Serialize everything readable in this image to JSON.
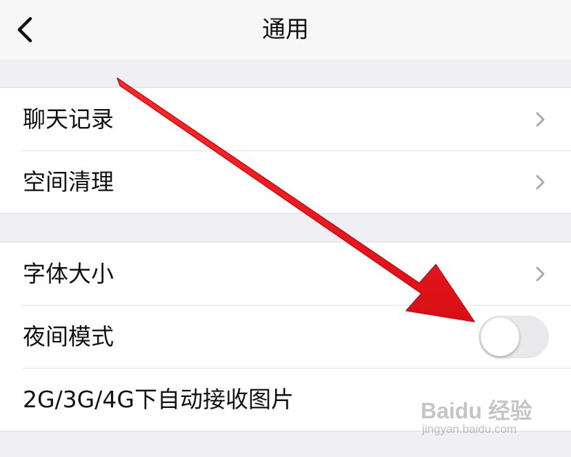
{
  "header": {
    "title": "通用",
    "back_icon": "chevron-left-icon"
  },
  "groups": [
    {
      "items": [
        {
          "label": "聊天记录",
          "accessory": "chevron-right-icon"
        },
        {
          "label": "空间清理",
          "accessory": "chevron-right-icon"
        }
      ]
    },
    {
      "items": [
        {
          "label": "字体大小",
          "accessory": "chevron-right-icon"
        },
        {
          "label": "夜间模式",
          "accessory": "toggle",
          "toggle_on": false
        },
        {
          "label": "2G/3G/4G下自动接收图片",
          "accessory": "none"
        }
      ]
    }
  ],
  "annotation": {
    "arrow_color": "#e8141c",
    "points_to": "夜间模式"
  },
  "watermark": {
    "logo": "Baidu 经验",
    "url": "jingyan.baidu.com"
  },
  "colors": {
    "background": "#efeff4",
    "cell": "#ffffff",
    "chevron": "#a8a8ad",
    "toggle_off": "#e9e9eb"
  }
}
